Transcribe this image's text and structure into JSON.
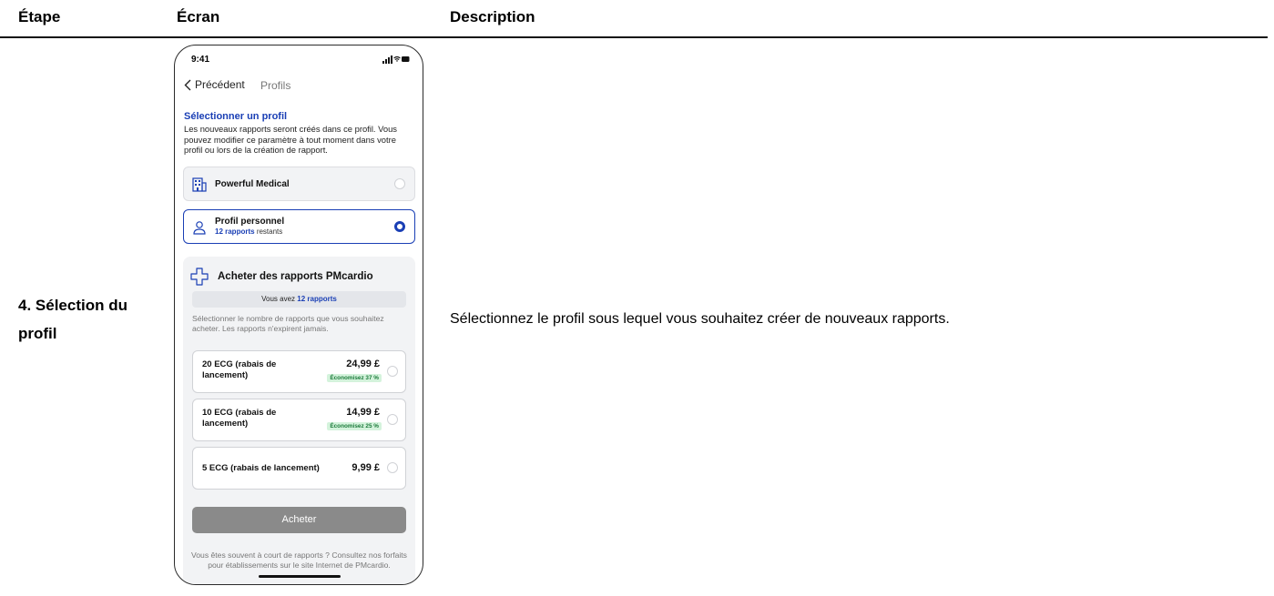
{
  "table": {
    "headers": {
      "step": "Étape",
      "screen": "Écran",
      "description": "Description"
    },
    "row": {
      "step": "4. Sélection du profil",
      "description": "Sélectionnez le profil sous lequel vous souhaitez créer de nouveaux rapports."
    }
  },
  "phone": {
    "status_time": "9:41",
    "nav": {
      "back_label": "Précédent",
      "title": "Profils"
    },
    "select": {
      "title": "Sélectionner un profil",
      "description": "Les nouveaux rapports seront créés dans ce profil. Vous pouvez modifier ce paramètre à tout moment dans votre profil ou lors de la création de rapport."
    },
    "profiles": [
      {
        "name": "Powerful Medical",
        "icon": "building-icon",
        "selected": false
      },
      {
        "name": "Profil personnel",
        "count": "12 rapports",
        "suffix": "restants",
        "icon": "person-icon",
        "selected": true
      }
    ],
    "buy": {
      "title": "Acheter des rapports PMcardio",
      "have_prefix": "Vous avez",
      "have_count": "12 rapports",
      "hint": "Sélectionner le nombre de rapports que vous souhaitez acheter. Les rapports n'expirent jamais.",
      "options": [
        {
          "name": "20 ECG (rabais de lancement)",
          "price": "24,99 £",
          "badge": "Économisez 37 %"
        },
        {
          "name": "10 ECG (rabais de lancement)",
          "price": "14,99 £",
          "badge": "Économisez 25 %"
        },
        {
          "name": "5 ECG (rabais de lancement)",
          "price": "9,99 £"
        }
      ],
      "button": "Acheter",
      "footnote": "Vous êtes souvent à court de rapports ? Consultez nos forfaits pour établissements sur le site Internet de PMcardio."
    },
    "colors": {
      "accent": "#1a3fb5",
      "savings_bg": "#d4f3dc",
      "button_disabled": "#8a8a8a"
    }
  }
}
